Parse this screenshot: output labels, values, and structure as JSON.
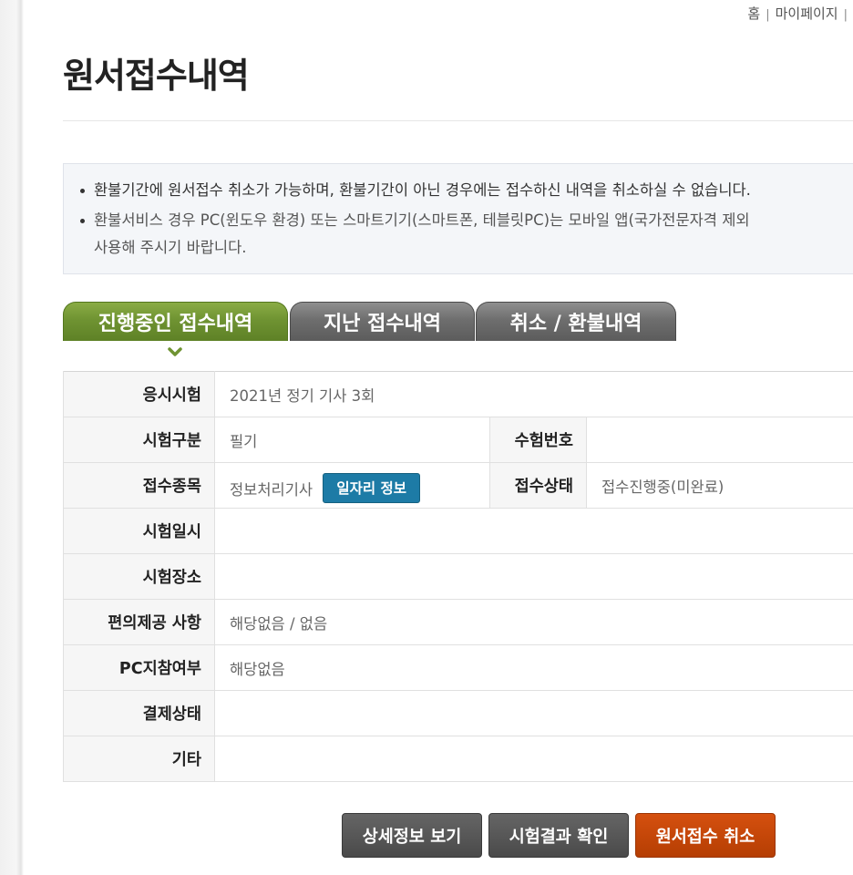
{
  "util_nav": {
    "home": "홈",
    "mypage": "마이페이지",
    "sep": "|"
  },
  "page": {
    "title": "원서접수내역"
  },
  "notice": {
    "item1": "환불기간에 원서접수 취소가 가능하며, 환불기간이 아닌 경우에는 접수하신 내역을 취소하실 수 없습니다.",
    "item2_line1": "환불서비스 경우 PC(윈도우 환경) 또는 스마트기기(스마트폰, 테블릿PC)는 모바일 앱(국가전문자격 제외",
    "item2_line2": "사용해 주시기 바랍니다."
  },
  "tabs": [
    {
      "label": "진행중인 접수내역",
      "active": true
    },
    {
      "label": "지난 접수내역",
      "active": false
    },
    {
      "label": "취소 / 환불내역",
      "active": false
    }
  ],
  "table": {
    "exam_label": "응시시험",
    "exam_value": "2021년 정기 기사 3회",
    "type_label": "시험구분",
    "type_value": "필기",
    "number_label": "수험번호",
    "number_value": "",
    "category_label": "접수종목",
    "category_value": "정보처리기사",
    "job_button": "일자리 정보",
    "status_label": "접수상태",
    "status_value": "접수진행중(미완료)",
    "datetime_label": "시험일시",
    "datetime_value": "",
    "place_label": "시험장소",
    "place_value": "",
    "convenience_label": "편의제공 사항",
    "convenience_value": "해당없음 / 없음",
    "pc_label": "PC지참여부",
    "pc_value": "해당없음",
    "payment_label": "결제상태",
    "payment_value": "",
    "etc_label": "기타",
    "etc_value": ""
  },
  "actions": {
    "detail": "상세정보 보기",
    "result": "시험결과 확인",
    "cancel": "원서접수 취소"
  },
  "colors": {
    "tab_active": "#6f9332",
    "tab_inactive": "#6e6e6e",
    "status_red": "#cc2a2a",
    "job_btn": "#1d7ba6",
    "cancel_btn": "#c4470a"
  }
}
